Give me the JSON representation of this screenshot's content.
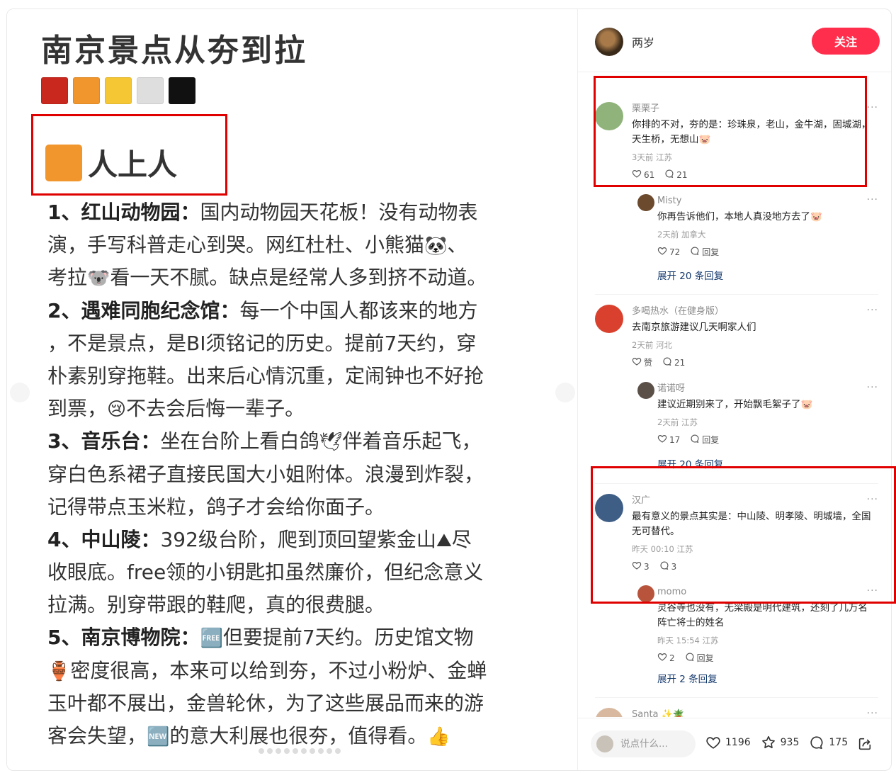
{
  "post": {
    "title": "南京景点从夯到拉",
    "swatch_colors": [
      "#c8281e",
      "#f0962d",
      "#f6c735",
      "#dedede",
      "#111111"
    ],
    "tier_color": "#f0962d",
    "tier_label": "人上人",
    "lines": [
      [
        {
          "b": "1、红山动物园："
        },
        {
          "t": "国内动物园天花板！没有动物表"
        }
      ],
      [
        {
          "t": "演，手写科普走心到哭。网红杜杜、小熊猫"
        },
        {
          "e": "🐼"
        },
        {
          "t": "、"
        }
      ],
      [
        {
          "t": "考拉"
        },
        {
          "e": "🐨"
        },
        {
          "t": "看一天不腻。缺点是经常人多到挤不动道。"
        }
      ],
      [
        {
          "b": "2、遇难同胞纪念馆："
        },
        {
          "t": "每一个中国人都该来的地方"
        }
      ],
      [
        {
          "t": "，不是景点，是BI须铭记的历史。提前7天约，穿"
        }
      ],
      [
        {
          "t": "朴素别穿拖鞋。出来后心情沉重，定闹钟也不好抢"
        }
      ],
      [
        {
          "t": "到票，"
        },
        {
          "e": "😢"
        },
        {
          "t": "不去会后悔一辈子。"
        }
      ],
      [
        {
          "b": "3、音乐台："
        },
        {
          "t": "坐在台阶上看白鸽"
        },
        {
          "e": "🕊"
        },
        {
          "t": "伴着音乐起飞，"
        }
      ],
      [
        {
          "t": "穿白色系裙子直接民国大小姐附体。浪漫到炸裂，"
        }
      ],
      [
        {
          "t": "记得带点玉米粒，鸽子才会给你面子。"
        }
      ],
      [
        {
          "b": "4、中山陵："
        },
        {
          "t": "392级台阶，爬到顶回望紫金山"
        },
        {
          "e": "⛰"
        },
        {
          "t": "尽"
        }
      ],
      [
        {
          "t": "收眼底。free领的小钥匙扣虽然廉价，但纪念意义"
        }
      ],
      [
        {
          "t": "拉满。别穿带跟的鞋爬，真的很费腿。"
        }
      ],
      [
        {
          "b": "5、南京博物院："
        },
        {
          "e": "🆓"
        },
        {
          "t": "但要提前7天约。历史馆文物"
        }
      ],
      [
        {
          "e": "🏺"
        },
        {
          "t": "密度很高，本来可以给到夯，不过小粉炉、金蝉"
        }
      ],
      [
        {
          "t": "玉叶都不展出，金兽轮休，为了这些展品而来的游"
        }
      ],
      [
        {
          "t": "客会失望，"
        },
        {
          "e": "🆕"
        },
        {
          "t": "的意大利展也很夯，值得看。"
        },
        {
          "e": "👍"
        }
      ]
    ]
  },
  "author": {
    "name": "两岁",
    "follow_label": "关注"
  },
  "comments": [
    {
      "name": "栗栗子",
      "text": "你排的不对，夯的是：珍珠泉，老山，金牛湖，固城湖，天生桥，无想山🐷",
      "meta": "3天前 江苏",
      "likes": "61",
      "replies": "21",
      "avatar_color": "#8fb37a",
      "reply": false
    },
    {
      "name": "Misty",
      "text": "你再告诉他们，本地人真没地方去了🐷",
      "meta": "2天前 加拿大",
      "likes": "72",
      "replies": "回复",
      "avatar_color": "#6b4a2e",
      "reply": true
    },
    {
      "name": "多喝热水（在健身版）",
      "text": "去南京旅游建议几天啊家人们",
      "meta": "2天前 河北",
      "likes": "赞",
      "replies": "21",
      "avatar_color": "#d9412e",
      "reply": false
    },
    {
      "name": "诺诺呀",
      "text": "建议近期别来了，开始飘毛絮子了🐷",
      "meta": "2天前 江苏",
      "likes": "17",
      "replies": "回复",
      "avatar_color": "#5a5048",
      "reply": true
    },
    {
      "name": "汉广",
      "text": "最有意义的景点其实是：中山陵、明孝陵、明城墙，全国无可替代。",
      "meta": "昨天 00:10 江苏",
      "likes": "3",
      "replies": "3",
      "avatar_color": "#3f5e86",
      "reply": false
    },
    {
      "name": "momo",
      "text": "灵谷寺也没有，无梁殿是明代建筑，还刻了几万名阵亡将士的姓名",
      "meta": "昨天 15:54 江苏",
      "likes": "2",
      "replies": "回复",
      "avatar_color": "#b8543c",
      "reply": true
    },
    {
      "name": "Santa ✨🪴",
      "text": "",
      "meta": "",
      "likes": "",
      "replies": "",
      "avatar_color": "#d8b9a0",
      "reply": false
    }
  ],
  "expand_labels": [
    "展开 20 条回复",
    "展开 20 条回复",
    "展开 2 条回复"
  ],
  "more_label": "···",
  "bottom": {
    "placeholder": "说点什么...",
    "likes": "1196",
    "stars": "935",
    "comments": "175"
  },
  "colors": {
    "accent": "#ff2e4d",
    "highlight": "#e00000",
    "link": "#13386c"
  }
}
